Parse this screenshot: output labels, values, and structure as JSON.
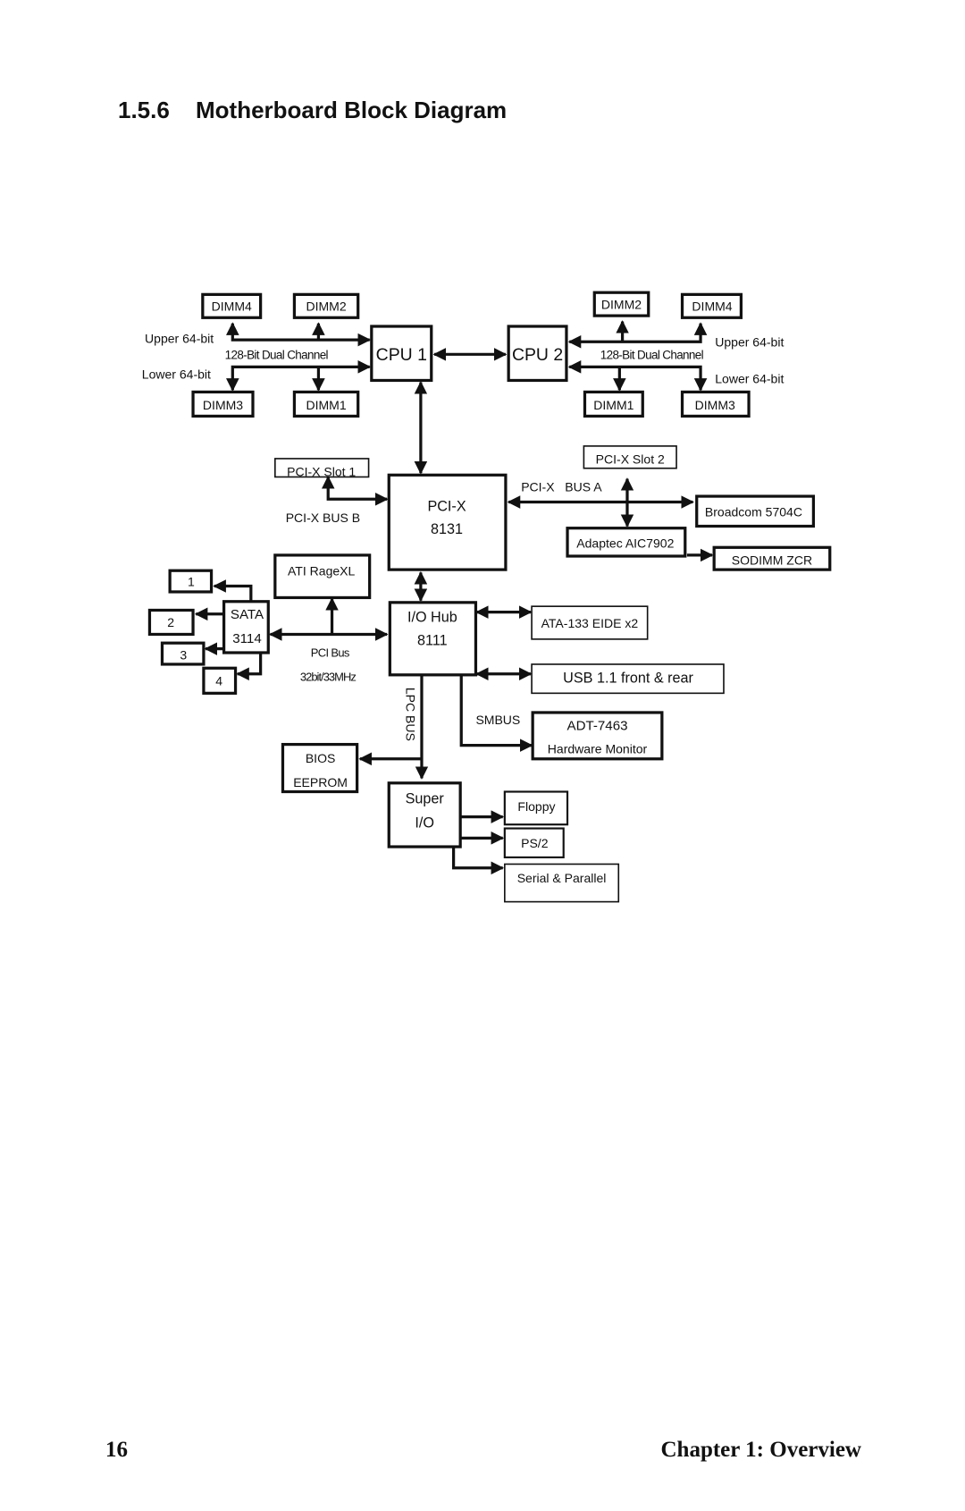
{
  "page": {
    "section_number": "1.5.6",
    "section_title": "Motherboard Block Diagram",
    "page_number": "16",
    "chapter": "Chapter 1: Overview"
  },
  "diagram": {
    "blocks": {
      "cpu1": "CPU 1",
      "cpu2": "CPU 2",
      "cpu1_dimm4": "DIMM4",
      "cpu1_dimm2": "DIMM2",
      "cpu1_dimm3": "DIMM3",
      "cpu1_dimm1": "DIMM1",
      "cpu2_dimm2": "DIMM2",
      "cpu2_dimm4": "DIMM4",
      "cpu2_dimm1": "DIMM1",
      "cpu2_dimm3": "DIMM3",
      "pcix_slot1": "PCI-X Slot 1",
      "pcix_slot2": "PCI-X Slot 2",
      "pcix_line1": "PCI-X",
      "pcix_line2": "8131",
      "broadcom": "Broadcom 5704C",
      "adaptec": "Adaptec AIC7902",
      "sodimm": "SODIMM ZCR",
      "ati": "ATI RageXL",
      "sata_line1": "SATA",
      "sata_line2": "3114",
      "port1": "1",
      "port2": "2",
      "port3": "3",
      "port4": "4",
      "iohub_line1": "I/O Hub",
      "iohub_line2": "8111",
      "ata": "ATA-133 EIDE x2",
      "usb": "USB 1.1 front & rear",
      "adt_line1": "ADT-7463",
      "adt_line2": "Hardware Monitor",
      "bios_line1": "BIOS",
      "bios_line2": "EEPROM",
      "superio_line1": "Super",
      "superio_line2": "I/O",
      "floppy": "Floppy",
      "ps2": "PS/2",
      "serial": "Serial & Parallel"
    },
    "labels": {
      "left_upper": "Upper 64-bit",
      "left_lower": "Lower 64-bit",
      "left_channel": "128-Bit Dual Channel",
      "right_upper": "Upper 64-bit",
      "right_lower": "Lower 64-bit",
      "right_channel": "128-Bit Dual Channel",
      "pcix_bus_b": "PCI-X BUS B",
      "pcix_bus_a": "PCI-X   BUS A",
      "pci_bus": "PCI Bus",
      "pci_bus_speed": "32bit/33MHz",
      "lpc_bus": "LPC BUS",
      "smbus": "SMBUS"
    }
  }
}
